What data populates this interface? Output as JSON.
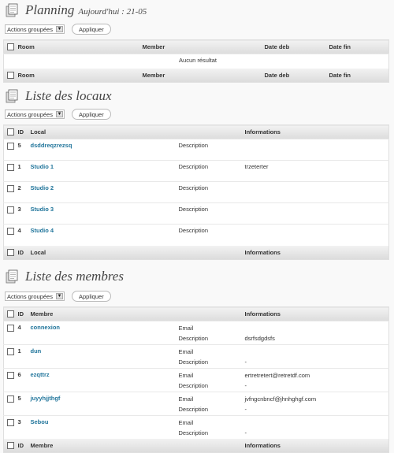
{
  "planning": {
    "title": "Planning",
    "subtitle": "Aujourd'hui : 21-05",
    "bulk_label": "Actions groupées",
    "apply_label": "Appliquer",
    "columns": [
      "Room",
      "Member",
      "Date deb",
      "Date fin"
    ],
    "empty_message": "Aucun résultat"
  },
  "locaux": {
    "title": "Liste des locaux",
    "bulk_label": "Actions groupées",
    "apply_label": "Appliquer",
    "columns": [
      "ID",
      "Local",
      "Informations"
    ],
    "rows": [
      {
        "id": "5",
        "name": "dsddreqzrezsq",
        "field": "Description",
        "value": ""
      },
      {
        "id": "1",
        "name": "Studio 1",
        "field": "Description",
        "value": "trzeterter"
      },
      {
        "id": "2",
        "name": "Studio 2",
        "field": "Description",
        "value": ""
      },
      {
        "id": "3",
        "name": "Studio 3",
        "field": "Description",
        "value": ""
      },
      {
        "id": "4",
        "name": "Studio 4",
        "field": "Description",
        "value": ""
      }
    ]
  },
  "membres": {
    "title": "Liste des membres",
    "bulk_label": "Actions groupées",
    "apply_label": "Appliquer",
    "columns": [
      "ID",
      "Membre",
      "Informations"
    ],
    "rows": [
      {
        "id": "4",
        "name": "connexion",
        "field1": "Email",
        "value1": "",
        "field2": "Description",
        "value2": "dsrfsdgdsfs"
      },
      {
        "id": "1",
        "name": "dun",
        "field1": "Email",
        "value1": "",
        "field2": "Description",
        "value2": "-"
      },
      {
        "id": "6",
        "name": "ezqttrz",
        "field1": "Email",
        "value1": "ertretretert@retretdf.com",
        "field2": "Description",
        "value2": "-"
      },
      {
        "id": "5",
        "name": "juyyhjjthgf",
        "field1": "Email",
        "value1": "jvfngcnbncf@jhnhghgf.com",
        "field2": "Description",
        "value2": "-"
      },
      {
        "id": "3",
        "name": "Sebou",
        "field1": "Email",
        "value1": "",
        "field2": "Description",
        "value2": "-"
      }
    ]
  }
}
